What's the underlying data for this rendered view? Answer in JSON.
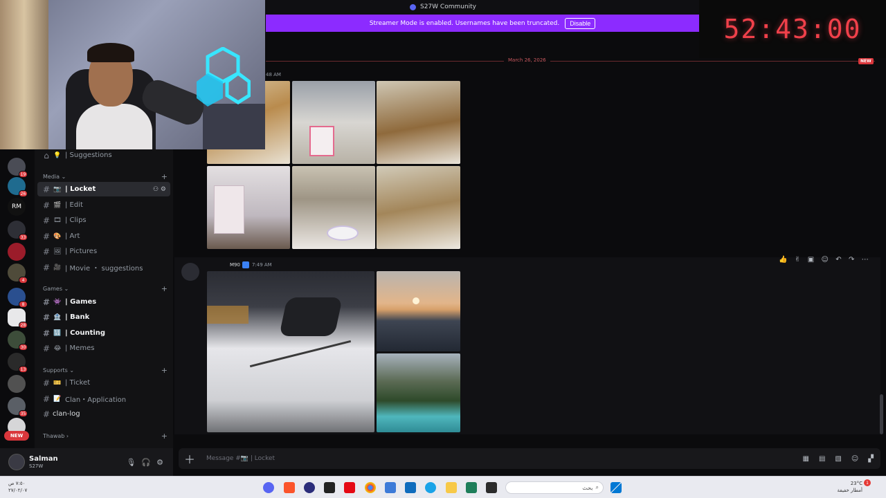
{
  "window_title": "S27W Community",
  "banner": {
    "text": "Streamer Mode is enabled. Usernames have been truncated.",
    "button": "Disable"
  },
  "timer": "52:43:00",
  "rail": {
    "badges": [
      "19",
      "26",
      "33",
      "4",
      "8",
      "28",
      "30",
      "13",
      "35"
    ],
    "rm_label": "RM",
    "new_label": "NEW"
  },
  "sidebar": {
    "suggestions": {
      "emoji": "💡",
      "label": "| Suggestions"
    },
    "cat_media": "Media",
    "media": [
      {
        "emoji": "📷",
        "label": "| Locket"
      },
      {
        "emoji": "🎬",
        "label": "| Edit"
      },
      {
        "emoji": "🎞",
        "label": "| Clips"
      },
      {
        "emoji": "🎨",
        "label": "| Art"
      },
      {
        "emoji": "🖼",
        "label": "| Pictures"
      },
      {
        "emoji": "🎥",
        "label": "| Movie ・ suggestions"
      }
    ],
    "cat_games": "Games",
    "games": [
      {
        "emoji": "👾",
        "label": "| Games"
      },
      {
        "emoji": "🏦",
        "label": "| Bank"
      },
      {
        "emoji": "🔢",
        "label": "| Counting"
      },
      {
        "emoji": "😂",
        "label": "| Memes"
      }
    ],
    "cat_supports": "Supports",
    "supports": [
      {
        "emoji": "🎫",
        "label": "| Ticket"
      },
      {
        "emoji": "📝",
        "label": "Clan・Application"
      }
    ],
    "clan_log": "clan-log",
    "cat_thawab": "Thawab"
  },
  "user": {
    "name": "Salman",
    "status": "S27W"
  },
  "chat": {
    "date_divider": "March 26, 2026",
    "new_tag": "NEW",
    "first_time": "48 AM",
    "second_role": "M90",
    "second_time": "7:49 AM"
  },
  "composer": {
    "placeholder": "Message #📷 | Locket"
  },
  "taskbar": {
    "time": "٧:٥٠ ص",
    "date": "٢٧/٠٢/٠٧",
    "search": "بحث",
    "weather_temp": "23°C",
    "weather_desc": "أمطار خفيفة",
    "notify_count": "1"
  },
  "colors": {
    "accent": "#8c2bff",
    "timer": "#f0404a",
    "badge": "#da373c"
  }
}
